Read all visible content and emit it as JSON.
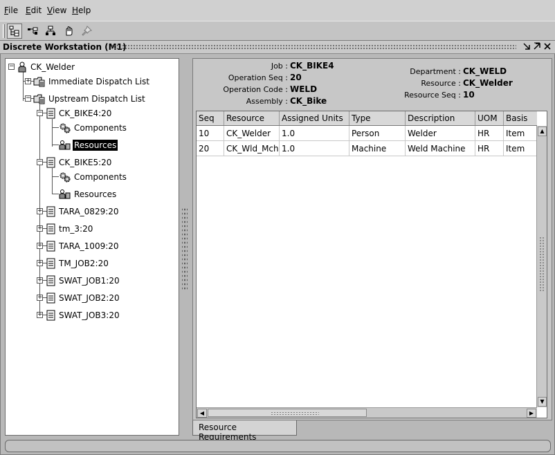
{
  "menu": {
    "items": [
      {
        "label": "File"
      },
      {
        "label": "Edit"
      },
      {
        "label": "View"
      },
      {
        "label": "Help"
      }
    ]
  },
  "toolbar": {
    "buttons": [
      {
        "icon": "tree-view-icon",
        "pressed": true
      },
      {
        "icon": "gantt-view-icon",
        "pressed": false
      },
      {
        "icon": "hierarchy-view-icon",
        "pressed": false
      },
      {
        "icon": "hand-cursor-icon",
        "pressed": false
      },
      {
        "icon": "pin-icon",
        "pressed": false
      }
    ]
  },
  "window": {
    "title": "Discrete Workstation (M1)",
    "controls": [
      "minimize-icon",
      "restore-icon",
      "close-icon"
    ]
  },
  "tree": {
    "root": {
      "label": "CK_Welder",
      "icon": "person-icon"
    },
    "lists": [
      {
        "label": "Immediate Dispatch List",
        "icon": "folder-list-icon",
        "expanded": false
      },
      {
        "label": "Upstream Dispatch List",
        "icon": "folder-list-icon",
        "expanded": true
      }
    ],
    "jobs": [
      {
        "label": "CK_BIKE4:20",
        "expanded": true,
        "children": [
          {
            "label": "Components",
            "icon": "gears-icon"
          },
          {
            "label": "Resources",
            "icon": "resource-person-icon",
            "selected": true
          }
        ]
      },
      {
        "label": "CK_BIKE5:20",
        "expanded": true,
        "children": [
          {
            "label": "Components",
            "icon": "gears-icon"
          },
          {
            "label": "Resources",
            "icon": "resource-person-icon",
            "selected": false
          }
        ]
      },
      {
        "label": "TARA_0829:20",
        "expanded": false
      },
      {
        "label": "tm_3:20",
        "expanded": false
      },
      {
        "label": "TARA_1009:20",
        "expanded": false
      },
      {
        "label": "TM_JOB2:20",
        "expanded": false
      },
      {
        "label": "SWAT_JOB1:20",
        "expanded": false
      },
      {
        "label": "SWAT_JOB2:20",
        "expanded": false
      },
      {
        "label": "SWAT_JOB3:20",
        "expanded": false
      }
    ]
  },
  "details": {
    "job": {
      "label": "Job :",
      "value": "CK_BIKE4"
    },
    "operation_seq": {
      "label": "Operation Seq :",
      "value": "20"
    },
    "operation_code": {
      "label": "Operation Code :",
      "value": "WELD"
    },
    "assembly": {
      "label": "Assembly :",
      "value": "CK_Bike"
    },
    "department": {
      "label": "Department :",
      "value": "CK_WELD"
    },
    "resource": {
      "label": "Resource :",
      "value": "CK_Welder"
    },
    "resource_seq": {
      "label": "Resource Seq :",
      "value": "10"
    }
  },
  "table": {
    "columns": [
      "Seq",
      "Resource",
      "Assigned Units",
      "Type",
      "Description",
      "UOM",
      "Basis"
    ],
    "rows": [
      [
        "10",
        "CK_Welder",
        "1.0",
        "Person",
        "Welder",
        "HR",
        "Item"
      ],
      [
        "20",
        "CK_Wld_Mch",
        "1.0",
        "Machine",
        "Weld Machine",
        "HR",
        "Item"
      ]
    ]
  },
  "tabs": [
    {
      "label": "Resource Requirements",
      "active": true
    }
  ]
}
